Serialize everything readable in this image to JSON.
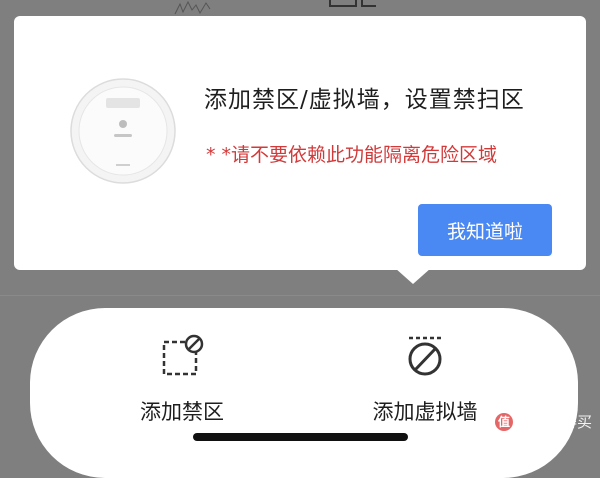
{
  "popup": {
    "title": "添加禁区/虚拟墙，设置禁扫区",
    "warning": "* *请不要依赖此功能隔离危险区域",
    "ack_button": "我知道啦"
  },
  "tools": {
    "zone_label": "添加禁区",
    "wall_label": "添加虚拟墙"
  },
  "watermark": {
    "text": "什么值得买",
    "logo_char": "值"
  },
  "colors": {
    "accent": "#4a89f3",
    "warning": "#d23a3a",
    "overlay": "#7f7f7f"
  },
  "icons": [
    "robot-vacuum-image",
    "no-go-zone-icon",
    "virtual-wall-icon"
  ]
}
